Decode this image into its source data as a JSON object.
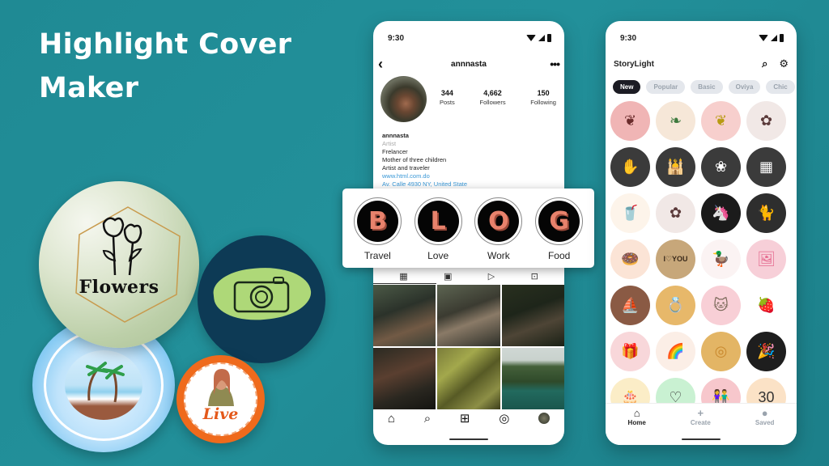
{
  "headline": {
    "line1": "Highlight Cover",
    "line2": "Maker"
  },
  "decor": {
    "flowers_label": "Flowers",
    "live_label": "Live",
    "colors": {
      "background": "#1f8a94",
      "camera_bg": "#0d3a55",
      "live_ring": "#ef6a1c"
    }
  },
  "instagram_phone": {
    "status_time": "9:30",
    "username": "annnasta",
    "stats": [
      {
        "value": "344",
        "label": "Posts"
      },
      {
        "value": "4,662",
        "label": "Followers"
      },
      {
        "value": "150",
        "label": "Following"
      }
    ],
    "bio": {
      "name": "annnasta",
      "category": "Artist",
      "lines": [
        "Frelancer",
        "Mother of three children",
        "Artist and traveler"
      ],
      "website": "www.html.com.do",
      "address": "Av. Calle 4930 NY, United State"
    },
    "highlights": [
      {
        "letter": "B",
        "label": "Travel"
      },
      {
        "letter": "L",
        "label": "Love"
      },
      {
        "letter": "O",
        "label": "Work"
      },
      {
        "letter": "G",
        "label": "Food"
      }
    ],
    "profile_tabs": [
      {
        "icon": "grid-icon",
        "glyph": "▦"
      },
      {
        "icon": "reels-icon",
        "glyph": "▣"
      },
      {
        "icon": "play-icon",
        "glyph": "▷"
      },
      {
        "icon": "tagged-icon",
        "glyph": "⊡"
      }
    ],
    "bottom_nav": [
      {
        "icon": "home-icon",
        "glyph": "⌂"
      },
      {
        "icon": "search-icon",
        "glyph": "⌕"
      },
      {
        "icon": "add-post-icon",
        "glyph": "⊞"
      },
      {
        "icon": "messenger-icon",
        "glyph": "◎"
      }
    ]
  },
  "storylight_phone": {
    "status_time": "9:30",
    "app_title": "StoryLight",
    "search_glyph": "⌕",
    "settings_glyph": "⚙",
    "chips": [
      {
        "label": "New",
        "active": true
      },
      {
        "label": "Popular",
        "active": false
      },
      {
        "label": "Basic",
        "active": false
      },
      {
        "label": "Oviya",
        "active": false
      },
      {
        "label": "Chic",
        "active": false
      }
    ],
    "covers": [
      {
        "name": "branch-cover",
        "glyph": "❦",
        "bg": "#f0b5b5",
        "fg": "#6a2b2b"
      },
      {
        "name": "leaf-cover",
        "glyph": "❧",
        "bg": "#f6e7d8",
        "fg": "#3e7a3e"
      },
      {
        "name": "yellow-leaf-cover",
        "glyph": "❦",
        "bg": "#f7cfcd",
        "fg": "#b89a12"
      },
      {
        "name": "clover-cover",
        "glyph": "✿",
        "bg": "#f1e8e6",
        "fg": "#5b3a3a"
      },
      {
        "name": "diya-cover",
        "glyph": "✋",
        "bg": "#3b3b3b",
        "fg": "#ffffff"
      },
      {
        "name": "taj-mahal-cover",
        "glyph": "🕌",
        "bg": "#3b3b3b",
        "fg": "#ffffff"
      },
      {
        "name": "peacock-cover",
        "glyph": "❀",
        "bg": "#3b3b3b",
        "fg": "#ffffff"
      },
      {
        "name": "knitting-cover",
        "glyph": "▦",
        "bg": "#3b3b3b",
        "fg": "#ffffff"
      },
      {
        "name": "drink-cover",
        "glyph": "🥤",
        "bg": "#fdf4ea",
        "fg": "#e6a85a"
      },
      {
        "name": "clover-cover-2",
        "glyph": "✿",
        "bg": "#f1e8e6",
        "fg": "#5b3a3a"
      },
      {
        "name": "unicorn-cover",
        "glyph": "🦄",
        "bg": "#1b1b1b",
        "fg": "#b04ee0"
      },
      {
        "name": "cat-cover",
        "glyph": "🐈",
        "bg": "#2e2e2e",
        "fg": "#ffffff"
      },
      {
        "name": "donut-cover",
        "glyph": "🍩",
        "bg": "#fbe4d6",
        "fg": "#6b3a1f"
      },
      {
        "name": "i-love-you-cover",
        "glyph": "I♡YOU",
        "bg": "#c7a77a",
        "fg": "#3a2a1a"
      },
      {
        "name": "duck-cover",
        "glyph": "🦆",
        "bg": "#fbf3f3",
        "fg": "#e8b94a"
      },
      {
        "name": "photo-cover",
        "glyph": "🖼",
        "bg": "#f7cfd8",
        "fg": "#e56a8f"
      },
      {
        "name": "boat-cover",
        "glyph": "⛵",
        "bg": "#8a5a44",
        "fg": "#f3d4a8"
      },
      {
        "name": "ring-cover",
        "glyph": "💍",
        "bg": "#e7b86a",
        "fg": "#c9892e"
      },
      {
        "name": "kitten-cover",
        "glyph": "🐱",
        "bg": "#f8cfd6",
        "fg": "#7b6a5a"
      },
      {
        "name": "strawberry-cover",
        "glyph": "🍓",
        "bg": "#ffffff",
        "fg": "#e2525a"
      },
      {
        "name": "gift-cover",
        "glyph": "🎁",
        "bg": "#f8d7da",
        "fg": "#e68d9a"
      },
      {
        "name": "rainbow-cover",
        "glyph": "🌈",
        "bg": "#fbeee6",
        "fg": "#b07a5a"
      },
      {
        "name": "rings-cover",
        "glyph": "◎",
        "bg": "#e3b565",
        "fg": "#c9892e"
      },
      {
        "name": "party-cover",
        "glyph": "🎉",
        "bg": "#1e1e1e",
        "fg": "#e85ad0"
      },
      {
        "name": "cake-cover",
        "glyph": "🎂",
        "bg": "#fbedc7",
        "fg": "#333333"
      },
      {
        "name": "hearts-cover",
        "glyph": "♡",
        "bg": "#c9f1d2",
        "fg": "#333333"
      },
      {
        "name": "couple-cover",
        "glyph": "👫",
        "bg": "#f7c7cc",
        "fg": "#333333"
      },
      {
        "name": "thirty-cover",
        "glyph": "30",
        "bg": "#fbe2c6",
        "fg": "#333333"
      }
    ],
    "bottom_nav": [
      {
        "label": "Home",
        "glyph": "⌂",
        "active": true
      },
      {
        "label": "Create",
        "glyph": "+",
        "active": false
      },
      {
        "label": "Saved",
        "glyph": "●",
        "active": false
      }
    ]
  }
}
